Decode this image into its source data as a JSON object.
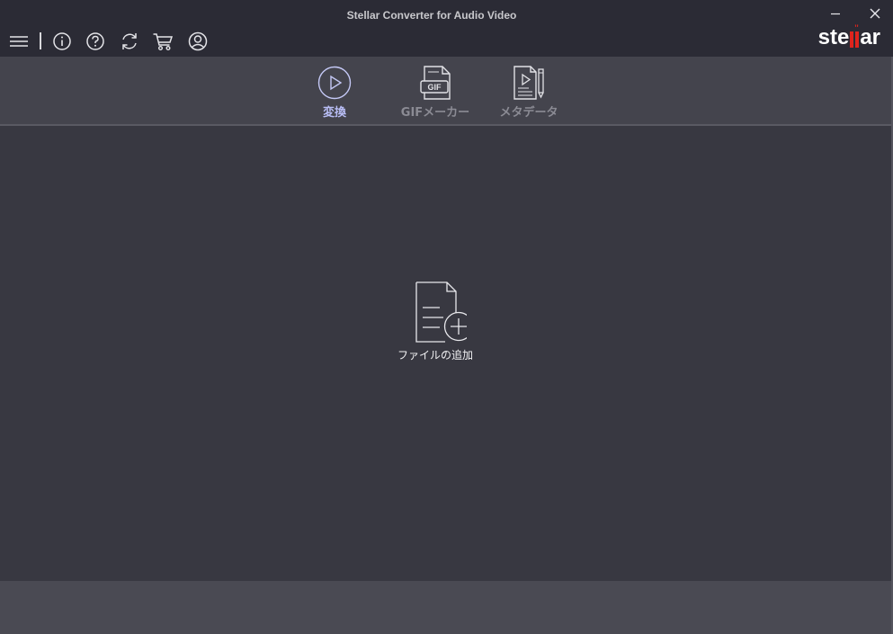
{
  "window": {
    "title": "Stellar Converter for Audio Video",
    "minimize_icon": "minimize-icon",
    "close_icon": "close-icon"
  },
  "toolbar": {
    "icons": [
      "menu-icon",
      "info-icon",
      "help-icon",
      "refresh-icon",
      "cart-icon",
      "account-icon"
    ]
  },
  "logo": {
    "text_before": "ste",
    "text_after": "ar",
    "text": "stellar"
  },
  "modes": [
    {
      "label": "変換",
      "icon": "play-circle-icon",
      "active": true
    },
    {
      "label": "GIFメーカー",
      "icon": "gif-file-icon",
      "icon_text": "GIF",
      "active": false
    },
    {
      "label": "メタデータ",
      "icon": "metadata-edit-icon",
      "active": false
    }
  ],
  "main": {
    "add_file_label": "ファイルの追加",
    "add_file_icon": "add-file-icon"
  },
  "colors": {
    "titlebar": "#2b2b35",
    "modebar": "#44444d",
    "main": "#383841",
    "footer": "#4a4a53",
    "active_tab": "#b8bdf5",
    "inactive_tab": "#8b8b94",
    "brand_red": "#e0241d"
  }
}
